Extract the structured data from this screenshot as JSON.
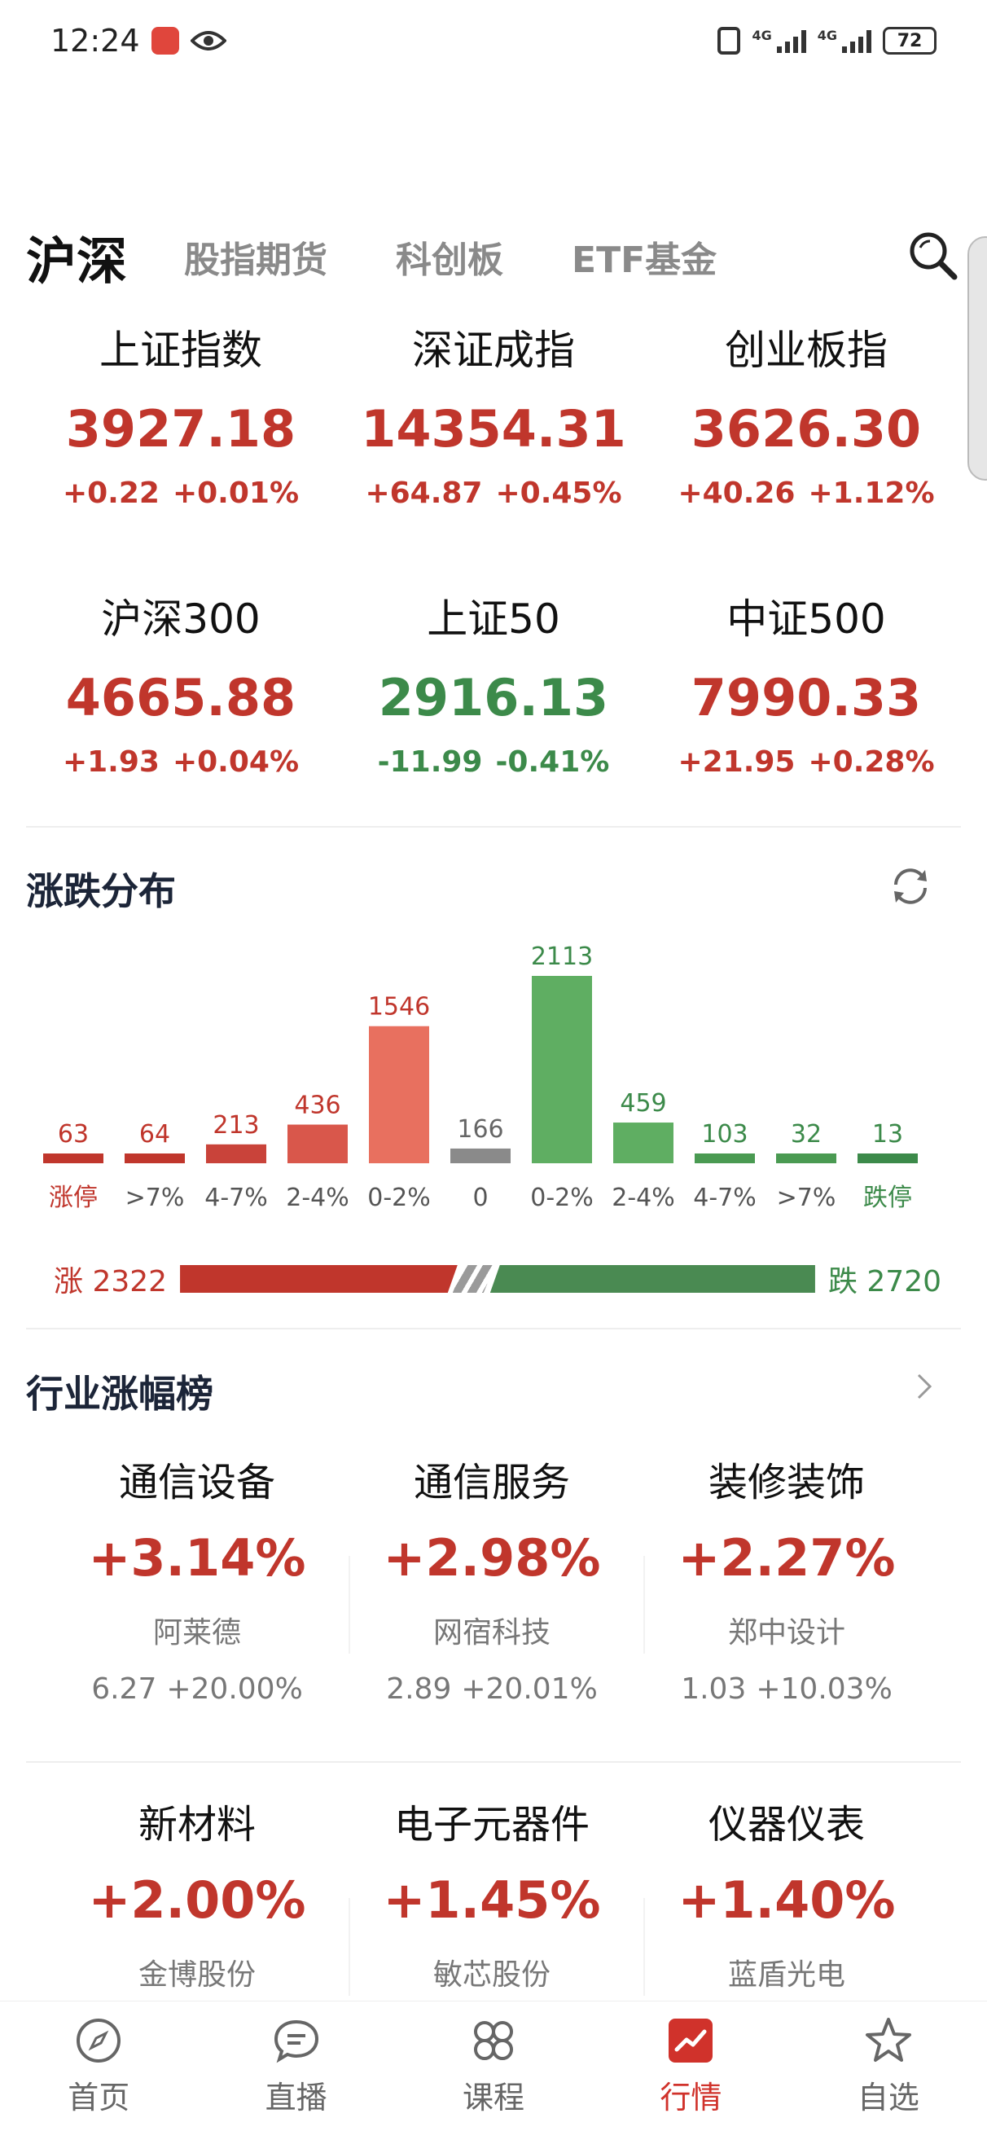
{
  "status_bar": {
    "time": "12:24",
    "battery": "72",
    "net1": "4G",
    "net2": "4G"
  },
  "tabs": [
    {
      "label": "沪深",
      "active": true
    },
    {
      "label": "股指期货",
      "active": false
    },
    {
      "label": "科创板",
      "active": false
    },
    {
      "label": "ETF基金",
      "active": false
    }
  ],
  "indices": [
    {
      "name": "上证指数",
      "value": "3927.18",
      "change": "+0.22",
      "pct": "+0.01%",
      "dir": "up"
    },
    {
      "name": "深证成指",
      "value": "14354.31",
      "change": "+64.87",
      "pct": "+0.45%",
      "dir": "up"
    },
    {
      "name": "创业板指",
      "value": "3626.30",
      "change": "+40.26",
      "pct": "+1.12%",
      "dir": "up"
    },
    {
      "name": "沪深300",
      "value": "4665.88",
      "change": "+1.93",
      "pct": "+0.04%",
      "dir": "up"
    },
    {
      "name": "上证50",
      "value": "2916.13",
      "change": "-11.99",
      "pct": "-0.41%",
      "dir": "down"
    },
    {
      "name": "中证500",
      "value": "7990.33",
      "change": "+21.95",
      "pct": "+0.28%",
      "dir": "up"
    }
  ],
  "distribution": {
    "title": "涨跌分布",
    "up_label": "涨 2322",
    "down_label": "跌 2720",
    "up_total": 2322,
    "down_total": 2720
  },
  "chart_data": {
    "type": "bar",
    "title": "涨跌分布",
    "categories": [
      "涨停",
      ">7%",
      "4-7%",
      "2-4%",
      "0-2%",
      "0",
      "0-2%",
      "2-4%",
      "4-7%",
      ">7%",
      "跌停"
    ],
    "values": [
      63,
      64,
      213,
      436,
      1546,
      166,
      2113,
      459,
      103,
      32,
      13
    ],
    "colors": [
      "#c0362c",
      "#c0362c",
      "#c9433a",
      "#d9574b",
      "#e8705f",
      "#8a8a8a",
      "#5fae62",
      "#5fae62",
      "#4a9a52",
      "#4a9a52",
      "#3c8a4a"
    ],
    "label_colors": [
      "#c0362c",
      "#c0362c",
      "#c0362c",
      "#c0362c",
      "#c0362c",
      "#666666",
      "#3c8a4a",
      "#3c8a4a",
      "#3c8a4a",
      "#3c8a4a",
      "#3c8a4a"
    ],
    "category_colors": [
      "#c0362c",
      "#555555",
      "#555555",
      "#555555",
      "#555555",
      "#555555",
      "#555555",
      "#555555",
      "#555555",
      "#555555",
      "#3c8a4a"
    ]
  },
  "industry": {
    "title": "行业涨幅榜",
    "items": [
      {
        "name": "通信设备",
        "change": "+3.14%",
        "stock": "阿莱德",
        "price": "6.27",
        "stock_pct": "+20.00%"
      },
      {
        "name": "通信服务",
        "change": "+2.98%",
        "stock": "网宿科技",
        "price": "2.89",
        "stock_pct": "+20.01%"
      },
      {
        "name": "装修装饰",
        "change": "+2.27%",
        "stock": "郑中设计",
        "price": "1.03",
        "stock_pct": "+10.03%"
      },
      {
        "name": "新材料",
        "change": "+2.00%",
        "stock": "金博股份",
        "price": "",
        "stock_pct": ""
      },
      {
        "name": "电子元器件",
        "change": "+1.45%",
        "stock": "敏芯股份",
        "price": "",
        "stock_pct": ""
      },
      {
        "name": "仪器仪表",
        "change": "+1.40%",
        "stock": "蓝盾光电",
        "price": "",
        "stock_pct": ""
      }
    ]
  },
  "bottom_nav": [
    {
      "label": "首页",
      "icon": "compass-icon",
      "active": false
    },
    {
      "label": "直播",
      "icon": "chat-bubble-icon",
      "active": false
    },
    {
      "label": "课程",
      "icon": "grid-icon",
      "active": false
    },
    {
      "label": "行情",
      "icon": "chart-icon",
      "active": true
    },
    {
      "label": "自选",
      "icon": "star-icon",
      "active": false
    }
  ],
  "colors": {
    "up": "#c0362c",
    "down": "#3c8a4a",
    "accent": "#d0322b"
  }
}
